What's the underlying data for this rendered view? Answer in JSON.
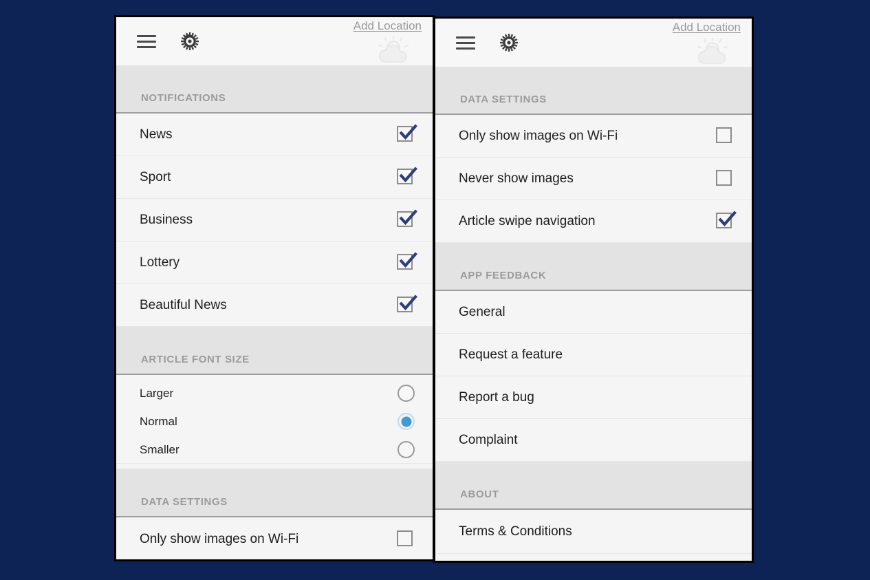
{
  "theme": {
    "page_background": "#0d2255",
    "panel_background": "#f5f5f5",
    "appbar_background": "#f7f7f7",
    "section_header_background": "#e3e3e3",
    "section_header_text": "#9b9b9b",
    "row_text": "#1d1d1d",
    "checkbox_tick": "#2c3e7b",
    "radio_selected": "#3f9bd2",
    "link_text": "#9a9a9a",
    "panel_border": "#000000"
  },
  "appbar": {
    "menu_icon": "hamburger-menu-icon",
    "settings_icon": "gear-icon",
    "add_location_label": "Add Location",
    "weather_icon": "sun-behind-cloud-icon"
  },
  "panels": [
    {
      "id": "left-settings-panel",
      "sections": [
        {
          "id": "notifications",
          "title": "NOTIFICATIONS",
          "type": "checkbox",
          "rows": [
            {
              "label": "News",
              "checked": true
            },
            {
              "label": "Sport",
              "checked": true
            },
            {
              "label": "Business",
              "checked": true
            },
            {
              "label": "Lottery",
              "checked": true
            },
            {
              "label": "Beautiful News",
              "checked": true
            }
          ]
        },
        {
          "id": "article-font-size",
          "title": "ARTICLE FONT SIZE",
          "type": "radio",
          "selected": "Normal",
          "rows": [
            {
              "label": "Larger",
              "selected": false
            },
            {
              "label": "Normal",
              "selected": true
            },
            {
              "label": "Smaller",
              "selected": false
            }
          ]
        },
        {
          "id": "data-settings",
          "title": "DATA SETTINGS",
          "type": "checkbox",
          "rows": [
            {
              "label": "Only show images on Wi-Fi",
              "checked": false
            }
          ]
        }
      ]
    },
    {
      "id": "right-settings-panel",
      "sections": [
        {
          "id": "data-settings",
          "title": "DATA SETTINGS",
          "type": "checkbox",
          "rows": [
            {
              "label": "Only show images on Wi-Fi",
              "checked": false
            },
            {
              "label": "Never show images",
              "checked": false
            },
            {
              "label": "Article swipe navigation",
              "checked": true
            }
          ]
        },
        {
          "id": "app-feedback",
          "title": "APP FEEDBACK",
          "type": "plain",
          "rows": [
            {
              "label": "General"
            },
            {
              "label": "Request a feature"
            },
            {
              "label": "Report a bug"
            },
            {
              "label": "Complaint"
            }
          ]
        },
        {
          "id": "about",
          "title": "ABOUT",
          "type": "plain",
          "rows": [
            {
              "label": "Terms & Conditions"
            }
          ]
        }
      ]
    }
  ]
}
